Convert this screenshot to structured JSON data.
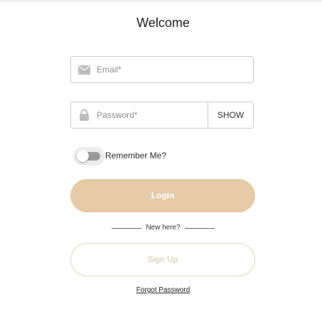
{
  "title": "Welcome",
  "email_field": {
    "placeholder": "Email*",
    "value": "",
    "icon": "envelope-icon"
  },
  "password_field": {
    "placeholder": "Password*",
    "value": "",
    "icon": "lock-icon",
    "show_label": "SHOW"
  },
  "remember": {
    "label": "Remember Me?",
    "checked": false
  },
  "login_label": "Login",
  "divider_text": "New here?",
  "signup_label": "Sign Up",
  "forgot_label": "Forgot Password",
  "colors": {
    "accent": "#e5caa7",
    "signup_text": "#d4c3ad",
    "field_border": "#c9c9c9",
    "icon_gray": "#bdbdbd",
    "toggle_track": "#9a9a9a"
  }
}
